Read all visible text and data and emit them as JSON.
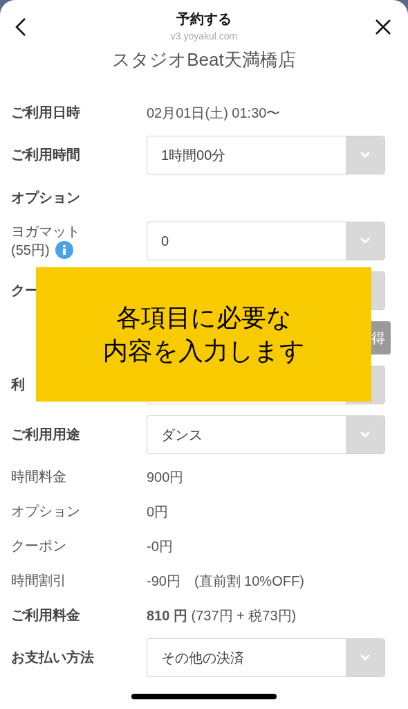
{
  "header": {
    "title": "予約する",
    "url": "v3.yoyakul.com",
    "store_name": "スタジオBeat天満橋店"
  },
  "rows": [
    {
      "kind": "text",
      "label": "ご利用日時",
      "bold": true,
      "value": "02月01日(土) 01:30〜"
    },
    {
      "kind": "select",
      "label": "ご利用時間",
      "bold": true,
      "value": "1時間00分"
    },
    {
      "kind": "section",
      "label": "オプション",
      "bold": true
    },
    {
      "kind": "select",
      "label": "ヨガマット",
      "label_2": "(55円)",
      "info": true,
      "bold": false,
      "value": "0"
    },
    {
      "kind": "select",
      "label": "クー",
      "bold": true
    },
    {
      "kind": "button",
      "label": "得"
    },
    {
      "kind": "select",
      "label": "利",
      "bold": true
    },
    {
      "kind": "select",
      "label": "ご利用用途",
      "bold": true,
      "value": "ダンス"
    },
    {
      "kind": "text",
      "label": "時間料金",
      "bold": false,
      "value": "900円"
    },
    {
      "kind": "text",
      "label": "オプション",
      "bold": false,
      "value": "0円"
    },
    {
      "kind": "text",
      "label": "クーポン",
      "bold": false,
      "value": "-0円"
    },
    {
      "kind": "text",
      "label": "時間割引",
      "bold": false,
      "value": "-90円　(直前割 10%OFF)"
    },
    {
      "kind": "text",
      "label": "ご利用料金",
      "bold": true,
      "value": "**810 円** (737円 + 税73円)"
    },
    {
      "kind": "select",
      "label": "お支払い方法",
      "bold": true,
      "value": "その他の決済"
    }
  ],
  "overlay": {
    "lines": [
      "各項目に必要な",
      "内容を入力します"
    ]
  }
}
